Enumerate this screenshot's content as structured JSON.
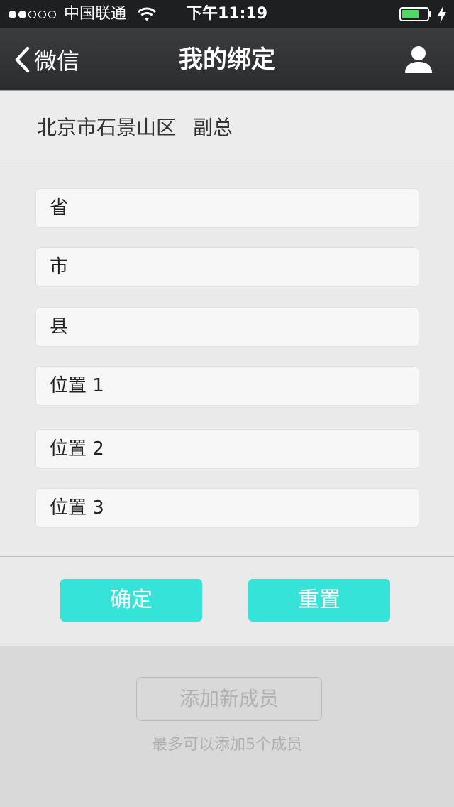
{
  "status_bar": {
    "carrier": "中国联通",
    "time": "下午11:19",
    "battery_color": "#4cd964"
  },
  "nav": {
    "back_label": "微信",
    "title": "我的绑定",
    "right_icon": "user-icon"
  },
  "location": {
    "area": "北京市石景山区",
    "role": "副总"
  },
  "form": {
    "fields": [
      {
        "placeholder": "省",
        "value": ""
      },
      {
        "placeholder": "市",
        "value": ""
      },
      {
        "placeholder": "县",
        "value": ""
      },
      {
        "placeholder": "位置 1",
        "value": ""
      },
      {
        "placeholder": "位置 2",
        "value": ""
      },
      {
        "placeholder": "位置 3",
        "value": ""
      }
    ]
  },
  "actions": {
    "confirm_label": "确定",
    "reset_label": "重置",
    "accent_color": "#36e3d8"
  },
  "members": {
    "add_label": "添加新成员",
    "hint": "最多可以添加5个成员"
  }
}
